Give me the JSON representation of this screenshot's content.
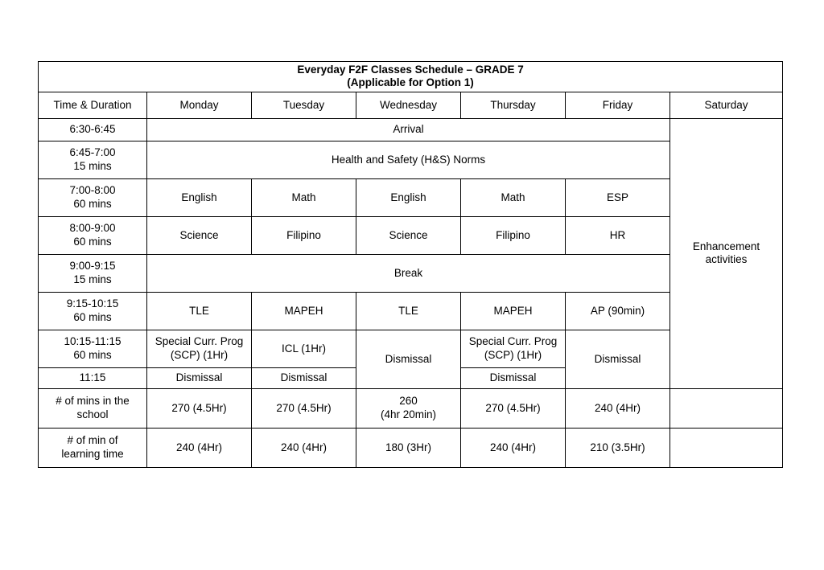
{
  "title": {
    "line1": "Everyday F2F Classes Schedule – GRADE 7",
    "line2": "(Applicable for Option 1)"
  },
  "columns": {
    "time": "Time & Duration",
    "monday": "Monday",
    "tuesday": "Tuesday",
    "wednesday": "Wednesday",
    "thursday": "Thursday",
    "friday": "Friday",
    "saturday": "Saturday"
  },
  "saturday": {
    "enhancement_line1": "Enhancement",
    "enhancement_line2": "activities"
  },
  "rows": {
    "arrival": {
      "time": "6:30-6:45",
      "duration": "",
      "label": "Arrival"
    },
    "hs_norms": {
      "time": "6:45-7:00",
      "duration": "15 mins",
      "label": "Health and Safety (H&S) Norms"
    },
    "period1": {
      "time": "7:00-8:00",
      "duration": "60 mins",
      "monday": "English",
      "tuesday": "Math",
      "wednesday": "English",
      "thursday": "Math",
      "friday": "ESP"
    },
    "period2": {
      "time": "8:00-9:00",
      "duration": "60 mins",
      "monday": "Science",
      "tuesday": "Filipino",
      "wednesday": "Science",
      "thursday": "Filipino",
      "friday": "HR"
    },
    "break": {
      "time": "9:00-9:15",
      "duration": "15 mins",
      "label": "Break"
    },
    "period3": {
      "time": "9:15-10:15",
      "duration": "60 mins",
      "monday": "TLE",
      "tuesday": "MAPEH",
      "wednesday": "TLE",
      "thursday": "MAPEH",
      "friday": "AP (90min)"
    },
    "period4": {
      "time": "10:15-11:15",
      "duration": "60 mins",
      "monday_line1": "Special Curr. Prog",
      "monday_line2": "(SCP) (1Hr)",
      "tuesday": "ICL (1Hr)",
      "wednesday": "Dismissal",
      "thursday_line1": "Special Curr. Prog",
      "thursday_line2": "(SCP) (1Hr)",
      "friday": "Dismissal"
    },
    "dismissal": {
      "time": "11:15",
      "monday": "Dismissal",
      "tuesday": "Dismissal",
      "thursday": "Dismissal"
    },
    "mins_in_school": {
      "label_line1": "# of mins in the",
      "label_line2": "school",
      "monday": "270 (4.5Hr)",
      "tuesday": "270 (4.5Hr)",
      "wednesday_line1": "260",
      "wednesday_line2": "(4hr 20min)",
      "thursday": "270 (4.5Hr)",
      "friday": "240 (4Hr)"
    },
    "learning_time": {
      "label_line1": "# of min of",
      "label_line2": "learning time",
      "monday": "240 (4Hr)",
      "tuesday": "240 (4Hr)",
      "wednesday": "180 (3Hr)",
      "thursday": "240 (4Hr)",
      "friday": "210 (3.5Hr)"
    }
  },
  "colors": {
    "highlight_yellow": "#FFFF00",
    "english_peach": "#FBE2D0",
    "filipino_green": "#E5EDDC",
    "esp_blue": "#DEE8F1",
    "hr_blue": "#2E75B6",
    "tle_orange": "#F0A97F",
    "mapeh_gray": "#A6A6A6",
    "ap_cream": "#F7EFD6",
    "scp_green": "#4E7A30",
    "enhancement_red": "#C00000"
  }
}
